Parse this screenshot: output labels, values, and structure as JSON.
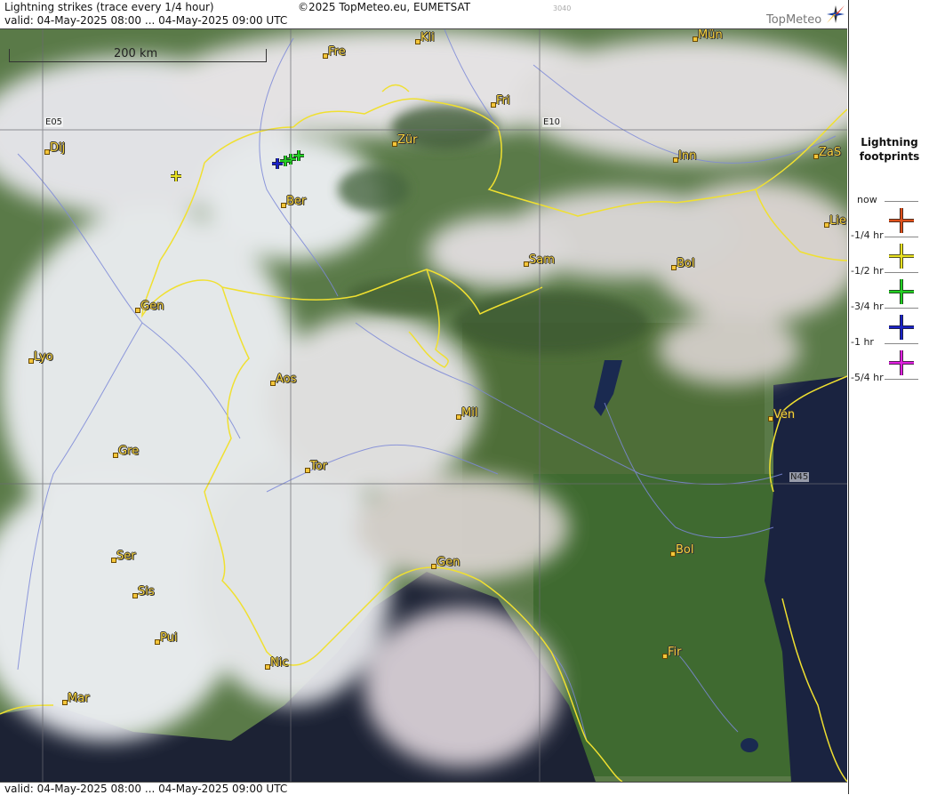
{
  "header": {
    "title": "Lightning strikes (trace every 1/4 hour)",
    "valid": "valid:  04-May-2025 08:00 ... 04-May-2025 09:00 UTC",
    "copyright": "©2025 TopMeteo.eu, EUMETSAT",
    "code": "3040",
    "brand": "TopMeteo"
  },
  "footer": {
    "valid": "valid:  04-May-2025 08:00 ... 04-May-2025 09:00 UTC"
  },
  "scale": {
    "label": "200 km"
  },
  "grid": {
    "e05": "E05",
    "e10": "E10",
    "n45": "N45"
  },
  "cities": [
    {
      "name": "Kli"
    },
    {
      "name": "Mün"
    },
    {
      "name": "Fre"
    },
    {
      "name": "Fri"
    },
    {
      "name": "Dij"
    },
    {
      "name": "Zür"
    },
    {
      "name": "Inn"
    },
    {
      "name": "ZaS"
    },
    {
      "name": "Ber"
    },
    {
      "name": "Lie"
    },
    {
      "name": "Sam"
    },
    {
      "name": "Bol"
    },
    {
      "name": "Gen"
    },
    {
      "name": "Lyo"
    },
    {
      "name": "Aos"
    },
    {
      "name": "Mil"
    },
    {
      "name": "Ven"
    },
    {
      "name": "Gre"
    },
    {
      "name": "Tor"
    },
    {
      "name": "Ser"
    },
    {
      "name": "Gen"
    },
    {
      "name": "Bol"
    },
    {
      "name": "Sis"
    },
    {
      "name": "Pui"
    },
    {
      "name": "Nic"
    },
    {
      "name": "Fir"
    },
    {
      "name": "Mar"
    }
  ],
  "legend": {
    "title": "Lightning footprints",
    "rows": [
      {
        "label": "now",
        "color": ""
      },
      {
        "label": "-1/4 hr",
        "color": "#e0501a"
      },
      {
        "label": "-1/2 hr",
        "color": "#e8e020"
      },
      {
        "label": "-3/4 hr",
        "color": "#22d022"
      },
      {
        "label": "-1 hr",
        "color": "#1a22c8"
      },
      {
        "label": "-5/4 hr",
        "color": "#e020e0"
      }
    ]
  },
  "strikes": [
    {
      "age": "-1/2 hr",
      "color": "#e8e020"
    },
    {
      "age": "-3/4 hr",
      "color": "#22d022"
    },
    {
      "age": "-3/4 hr",
      "color": "#22d022"
    },
    {
      "age": "-3/4 hr",
      "color": "#22d022"
    },
    {
      "age": "-1 hr",
      "color": "#1a22c8"
    }
  ],
  "colors": {
    "border": "#f0e030",
    "river": "#7c88d8",
    "sea": "#1a2340",
    "land": "#4a6e3a",
    "cloud": "#e8e6ea"
  }
}
